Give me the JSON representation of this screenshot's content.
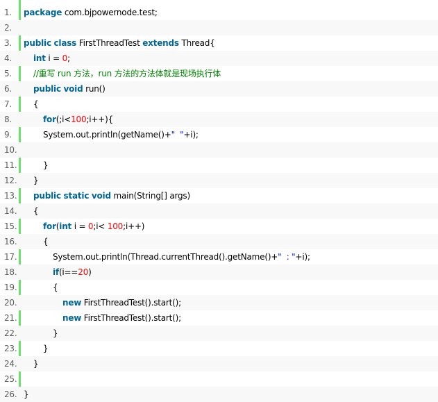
{
  "lines": [
    {
      "n": "1.",
      "indent": 0,
      "tokens": [
        {
          "t": "kw",
          "v": "package"
        },
        {
          "t": "p",
          "v": " com.bjpowernode.test;"
        }
      ]
    },
    {
      "n": "2.",
      "indent": 0,
      "tokens": []
    },
    {
      "n": "3.",
      "indent": 0,
      "tokens": [
        {
          "t": "kw",
          "v": "public"
        },
        {
          "t": "p",
          "v": " "
        },
        {
          "t": "kw",
          "v": "class"
        },
        {
          "t": "p",
          "v": " FirstThreadTest "
        },
        {
          "t": "kw",
          "v": "extends"
        },
        {
          "t": "p",
          "v": " Thread{"
        }
      ]
    },
    {
      "n": "4.",
      "indent": 1,
      "tokens": [
        {
          "t": "kw",
          "v": "int"
        },
        {
          "t": "p",
          "v": " i = "
        },
        {
          "t": "nm",
          "v": "0"
        },
        {
          "t": "p",
          "v": ";"
        }
      ]
    },
    {
      "n": "5.",
      "indent": 1,
      "tokens": [
        {
          "t": "cm",
          "v": "//重写 run 方法，run 方法的方法体就是现场执行体"
        }
      ]
    },
    {
      "n": "6.",
      "indent": 1,
      "tokens": [
        {
          "t": "kw",
          "v": "public"
        },
        {
          "t": "p",
          "v": " "
        },
        {
          "t": "kw",
          "v": "void"
        },
        {
          "t": "p",
          "v": " run()"
        }
      ]
    },
    {
      "n": "7.",
      "indent": 1,
      "tokens": [
        {
          "t": "p",
          "v": "{"
        }
      ]
    },
    {
      "n": "8.",
      "indent": 2,
      "tokens": [
        {
          "t": "kw",
          "v": "for"
        },
        {
          "t": "p",
          "v": "(;i<"
        },
        {
          "t": "nm",
          "v": "100"
        },
        {
          "t": "p",
          "v": ";i++){"
        }
      ]
    },
    {
      "n": "9.",
      "indent": 2,
      "tokens": [
        {
          "t": "p",
          "v": "System.out.println(getName()+"
        },
        {
          "t": "sc",
          "v": "\"  \""
        },
        {
          "t": "p",
          "v": "+i);"
        }
      ]
    },
    {
      "n": "10.",
      "indent": 0,
      "tokens": []
    },
    {
      "n": "11.",
      "indent": 2,
      "tokens": [
        {
          "t": "p",
          "v": "}"
        }
      ]
    },
    {
      "n": "12.",
      "indent": 1,
      "tokens": [
        {
          "t": "p",
          "v": "}"
        }
      ]
    },
    {
      "n": "13.",
      "indent": 1,
      "tokens": [
        {
          "t": "kw",
          "v": "public"
        },
        {
          "t": "p",
          "v": " "
        },
        {
          "t": "kw",
          "v": "static"
        },
        {
          "t": "p",
          "v": " "
        },
        {
          "t": "kw",
          "v": "void"
        },
        {
          "t": "p",
          "v": " main(String[] args)"
        }
      ]
    },
    {
      "n": "14.",
      "indent": 1,
      "tokens": [
        {
          "t": "p",
          "v": "{"
        }
      ]
    },
    {
      "n": "15.",
      "indent": 2,
      "tokens": [
        {
          "t": "kw",
          "v": "for"
        },
        {
          "t": "p",
          "v": "("
        },
        {
          "t": "kw",
          "v": "int"
        },
        {
          "t": "p",
          "v": " i = "
        },
        {
          "t": "nm",
          "v": "0"
        },
        {
          "t": "p",
          "v": ";i< "
        },
        {
          "t": "nm",
          "v": "100"
        },
        {
          "t": "p",
          "v": ";i++)"
        }
      ]
    },
    {
      "n": "16.",
      "indent": 2,
      "tokens": [
        {
          "t": "p",
          "v": "{"
        }
      ]
    },
    {
      "n": "17.",
      "indent": 3,
      "tokens": [
        {
          "t": "p",
          "v": "System.out.println(Thread.currentThread().getName()+"
        },
        {
          "t": "sc",
          "v": "\"  : \""
        },
        {
          "t": "p",
          "v": "+i);"
        }
      ]
    },
    {
      "n": "18.",
      "indent": 3,
      "tokens": [
        {
          "t": "kw",
          "v": "if"
        },
        {
          "t": "p",
          "v": "(i=="
        },
        {
          "t": "nm",
          "v": "20"
        },
        {
          "t": "p",
          "v": ")"
        }
      ]
    },
    {
      "n": "19.",
      "indent": 3,
      "tokens": [
        {
          "t": "p",
          "v": "{"
        }
      ]
    },
    {
      "n": "20.",
      "indent": 4,
      "tokens": [
        {
          "t": "kw",
          "v": "new"
        },
        {
          "t": "p",
          "v": " FirstThreadTest().start();"
        }
      ]
    },
    {
      "n": "21.",
      "indent": 4,
      "tokens": [
        {
          "t": "kw",
          "v": "new"
        },
        {
          "t": "p",
          "v": " FirstThreadTest().start();"
        }
      ]
    },
    {
      "n": "22.",
      "indent": 3,
      "tokens": [
        {
          "t": "p",
          "v": "}"
        }
      ]
    },
    {
      "n": "23.",
      "indent": 2,
      "tokens": [
        {
          "t": "p",
          "v": "}"
        }
      ]
    },
    {
      "n": "24.",
      "indent": 1,
      "tokens": [
        {
          "t": "p",
          "v": "}"
        }
      ]
    },
    {
      "n": "25.",
      "indent": 0,
      "tokens": []
    },
    {
      "n": "26.",
      "indent": 0,
      "tokens": [
        {
          "t": "p",
          "v": "}"
        }
      ]
    }
  ]
}
